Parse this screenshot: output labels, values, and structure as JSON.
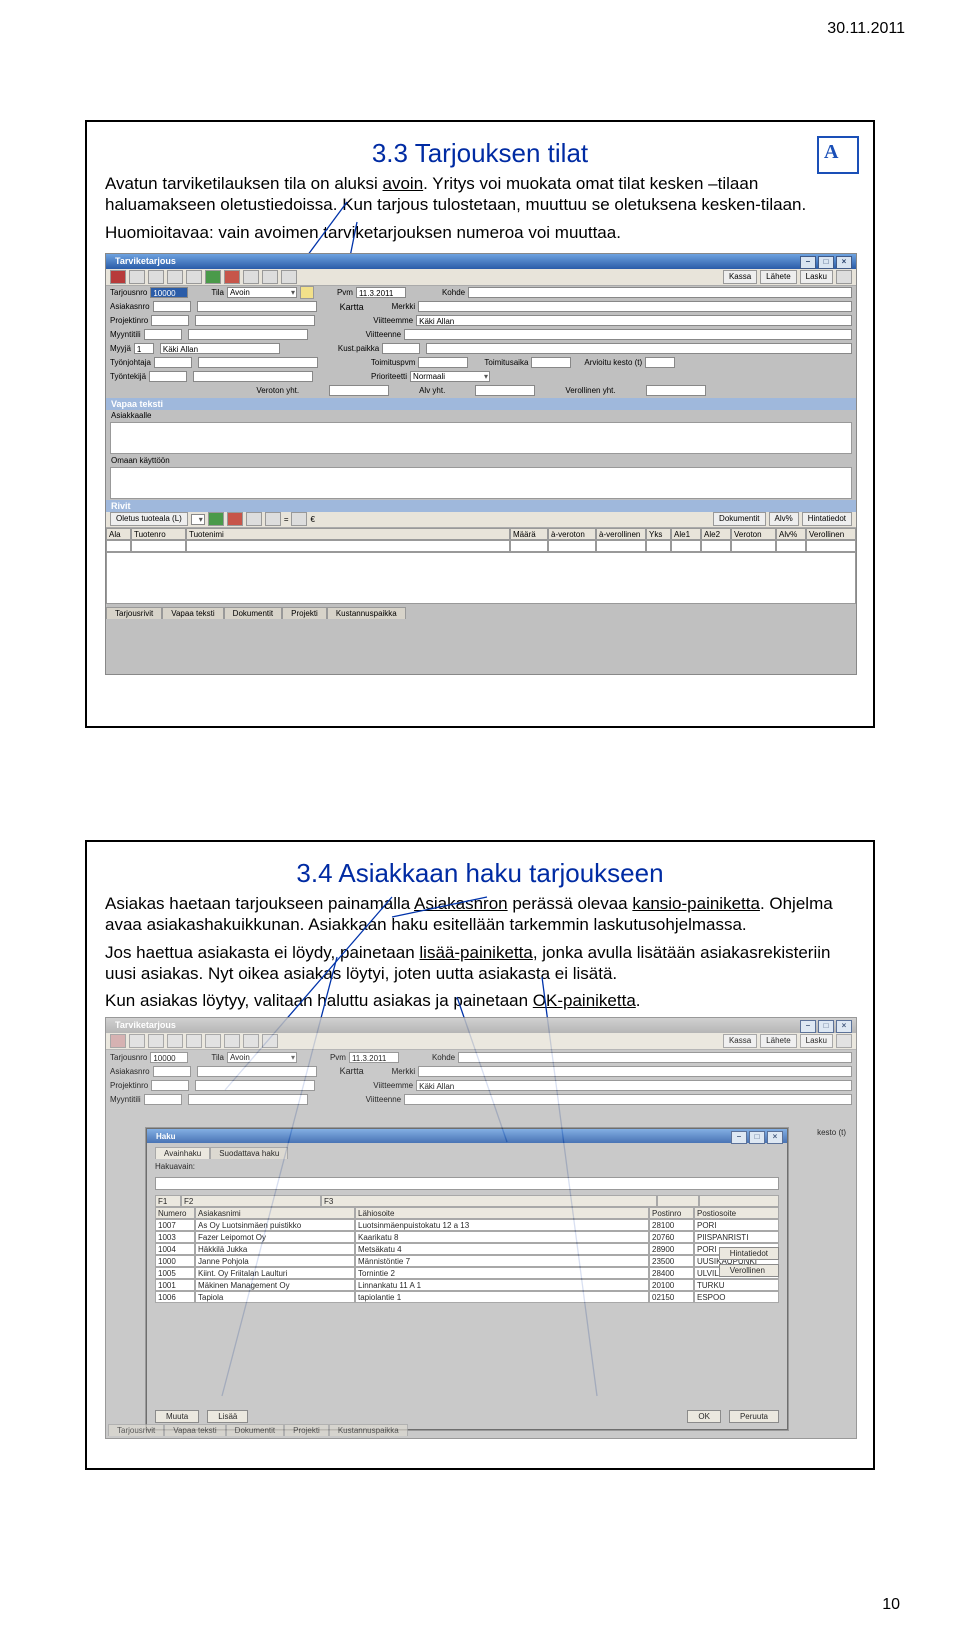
{
  "page": {
    "date": "30.11.2011",
    "number": "10"
  },
  "logo": {
    "letter": "A"
  },
  "slide1": {
    "title": "3.3 Tarjouksen tilat",
    "para1_a": "Avatun tarviketilauksen tila on aluksi ",
    "para1_u": "avoin",
    "para1_b": ". Yritys voi muokata omat tilat kesken –tilaan haluamakseen oletustiedoissa. Kun tarjous tulostetaan, muuttuu se oletuksena kesken-tilaan.",
    "para2": "Huomioitavaa: vain avoimen tarviketarjouksen numeroa voi muuttaa."
  },
  "slide2": {
    "title": "3.4 Asiakkaan haku tarjoukseen",
    "para1_a": "Asiakas haetaan tarjoukseen painamalla ",
    "para1_u1": "Asiakasnron",
    "para1_b": " perässä olevaa ",
    "para1_u2": "kansio-painiketta",
    "para1_c": ". Ohjelma avaa asiakashakuikkunan. Asiakkaan haku esitellään tarkemmin laskutusohjelmassa.",
    "para2_a": "Jos haettua asiakasta ei löydy, painetaan ",
    "para2_u": "lisää-painiketta",
    "para2_b": ", jonka avulla lisätään asiakasrekisteriin uusi asiakas. Nyt oikea asiakas löytyi, joten uutta asiakasta ei lisätä.",
    "para3_a": "Kun asiakas löytyy, valitaan haluttu asiakas ja painetaan ",
    "para3_u": "OK-painiketta",
    "para3_b": "."
  },
  "app": {
    "window_title": "Tarviketarjous",
    "toolbar_buttons": {
      "kassa": "Kassa",
      "lahete": "Lähete",
      "lasku": "Lasku"
    },
    "form": {
      "tarjousnro_lbl": "Tarjousnro",
      "tarjousnro_val": "10000",
      "tila_lbl": "Tila",
      "tila_val": "Avoin",
      "pvm_lbl": "Pvm",
      "pvm_val": "11.3.2011",
      "kohde_lbl": "Kohde",
      "asiakasnro_lbl": "Asiakasnro",
      "kartta_btn": "Kartta",
      "merkki_lbl": "Merkki",
      "projektinro_lbl": "Projektinro",
      "viitteemme_lbl": "Viitteemme",
      "viitteemme_val": "Käki Allan",
      "myyntitili_lbl": "Myyntitili",
      "viitteenne_lbl": "Viitteenne",
      "myyja_lbl": "Myyjä",
      "myyja_nro": "1",
      "myyja_val": "Käki Allan",
      "kustpaikka_lbl": "Kust.paikka",
      "tyonjohtaja_lbl": "Työnjohtaja",
      "toimituspvm_lbl": "Toimituspvm",
      "toimitusaika_lbl": "Toimitusaika",
      "arvioitu_lbl": "Arvioitu kesto (t)",
      "tyontekija_lbl": "Työntekijä",
      "prioriteetti_lbl": "Prioriteetti",
      "prioriteetti_val": "Normaali",
      "veroton_lbl": "Veroton yht.",
      "alv_lbl": "Alv yht.",
      "verollinen_lbl": "Verollinen yht."
    },
    "sections": {
      "vapaa_teksti": "Vapaa teksti",
      "asiakkaalle": "Asiakkaalle",
      "omaan": "Omaan käyttöön",
      "rivit": "Rivit"
    },
    "rivit_toolbar": {
      "oletus": "Oletus tuoteala (L)",
      "dokumentit": "Dokumentit",
      "alvp": "Alv%",
      "hintatiedot": "Hintatiedot"
    },
    "grid_cols": [
      "Ala",
      "Tuotenro",
      "Tuotenimi",
      "Määrä",
      "à-veroton",
      "à-verollinen",
      "Yks",
      "Ale1",
      "Ale2",
      "Veroton",
      "Alv%",
      "Verollinen"
    ],
    "tabs": [
      "Tarjousrivit",
      "Vapaa teksti",
      "Dokumentit",
      "Projekti",
      "Kustannuspaikka"
    ]
  },
  "modal": {
    "title": "Haku",
    "tabs": {
      "avain": "Avainhaku",
      "suod": "Suodattava haku"
    },
    "hakuavain_lbl": "Hakuavain:",
    "fkeys": {
      "f1": "F1",
      "f2": "F2",
      "f3": "F3"
    },
    "grid_cols": [
      "Numero",
      "Asiakasnimi",
      "Lähiosoite",
      "Postinro",
      "Postiosoite"
    ],
    "rows": [
      [
        "1007",
        "As Oy Luotsinmäen puistikko",
        "Luotsinmäenpuistokatu 12 a 13",
        "28100",
        "PORI"
      ],
      [
        "1003",
        "Fazer Leipomot Oy",
        "Kaarikatu 8",
        "20760",
        "PIISPANRISTI"
      ],
      [
        "1004",
        "Häkkilä Jukka",
        "Metsäkatu 4",
        "28900",
        "PORI"
      ],
      [
        "1000",
        "Janne Pohjola",
        "Männistöntie 7",
        "23500",
        "UUSIKAUPUNKI"
      ],
      [
        "1005",
        "Kiint. Oy Friitalan Laulturi",
        "Tornintie 2",
        "28400",
        "ULVILA"
      ],
      [
        "1001",
        "Mäkinen Management Oy",
        "Linnankatu 11 A 1",
        "20100",
        "TURKU"
      ],
      [
        "1006",
        "Tapiola",
        "tapiolantie 1",
        "02150",
        "ESPOO"
      ]
    ],
    "sidebtns": {
      "hinta": "Hintatiedot",
      "verollinen": "Verollinen"
    },
    "footer": {
      "muuta": "Muuta",
      "lisaa": "Lisää",
      "ok": "OK",
      "peruuta": "Peruuta"
    },
    "behind_labels": {
      "kesto": "kesto (t)"
    }
  }
}
